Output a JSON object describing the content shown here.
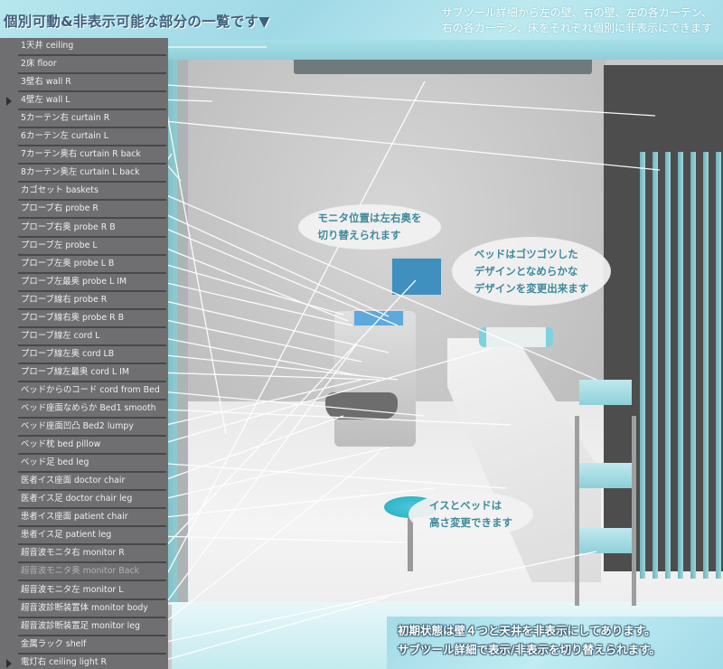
{
  "header": {
    "title": "個別可動&非表示可能な部分の一覧です▼",
    "note_line1": "サブツール詳細から左の壁、右の壁、左の各カーテン、",
    "note_line2": "右の各カーテン、床をそれぞれ個別に非表示にできます"
  },
  "parts_list": {
    "items": [
      {
        "label": "1天井 ceiling",
        "marked": false,
        "dim": false
      },
      {
        "label": "2床 floor",
        "marked": false,
        "dim": false
      },
      {
        "label": "3壁右 wall R",
        "marked": false,
        "dim": false
      },
      {
        "label": "4壁左 wall L",
        "marked": true,
        "dim": false
      },
      {
        "label": "5カーテン右 curtain R",
        "marked": false,
        "dim": false
      },
      {
        "label": "6カーテン左 curtain L",
        "marked": false,
        "dim": false
      },
      {
        "label": "7カーテン奥右 curtain R back",
        "marked": false,
        "dim": false
      },
      {
        "label": "8カーテン奥左 curtain L back",
        "marked": false,
        "dim": false
      },
      {
        "label": "カゴセット baskets",
        "marked": false,
        "dim": false
      },
      {
        "label": "プローブ右 probe R",
        "marked": false,
        "dim": false
      },
      {
        "label": "プローブ右奥 probe R B",
        "marked": false,
        "dim": false
      },
      {
        "label": "プローブ左 probe L",
        "marked": false,
        "dim": false
      },
      {
        "label": "プローブ左奥 probe L B",
        "marked": false,
        "dim": false
      },
      {
        "label": "プローブ左最奥 probe L IM",
        "marked": false,
        "dim": false
      },
      {
        "label": "プローブ線右 probe R",
        "marked": false,
        "dim": false
      },
      {
        "label": "プローブ線右奥 probe R B",
        "marked": false,
        "dim": false
      },
      {
        "label": "プローブ線左 cord L",
        "marked": false,
        "dim": false
      },
      {
        "label": "プローブ線左奥 cord LB",
        "marked": false,
        "dim": false
      },
      {
        "label": "プローブ線左最奥 cord L IM",
        "marked": false,
        "dim": false
      },
      {
        "label": "ベッドからのコード cord from Bed",
        "marked": false,
        "dim": false
      },
      {
        "label": "ベッド座面なめらか Bed1 smooth",
        "marked": false,
        "dim": false
      },
      {
        "label": "ベッド座面凹凸 Bed2 lumpy",
        "marked": false,
        "dim": false
      },
      {
        "label": "ベッド枕 bed pillow",
        "marked": false,
        "dim": false
      },
      {
        "label": "ベッド足 bed leg",
        "marked": false,
        "dim": false
      },
      {
        "label": "医者イス座面 doctor chair",
        "marked": false,
        "dim": false
      },
      {
        "label": "医者イス足 doctor chair leg",
        "marked": false,
        "dim": false
      },
      {
        "label": "患者イス座面 patient chair",
        "marked": false,
        "dim": false
      },
      {
        "label": "患者イス足  patient leg",
        "marked": false,
        "dim": false
      },
      {
        "label": "超音波モニタ右 monitor R",
        "marked": false,
        "dim": false
      },
      {
        "label": "超音波モニタ奥 monitor Back",
        "marked": false,
        "dim": true
      },
      {
        "label": "超音波モニタ左 monitor L",
        "marked": false,
        "dim": false
      },
      {
        "label": "超音波診断装置体 monitor body",
        "marked": false,
        "dim": false
      },
      {
        "label": "超音波診断装置足 monitor leg",
        "marked": false,
        "dim": false
      },
      {
        "label": "金属ラック shelf",
        "marked": false,
        "dim": false
      },
      {
        "label": "電灯右  ceiling light R",
        "marked": true,
        "dim": false
      }
    ]
  },
  "callouts": {
    "monitor": {
      "line1": "モニタ位置は左右奥を",
      "line2": "切り替えられます"
    },
    "bed": {
      "line1": "ベッドはゴツゴツした",
      "line2": "デザインとなめらかな",
      "line3": "デザインを変更出来ます"
    },
    "chair": {
      "line1": "イスとベッドは",
      "line2": "高さ変更できます"
    }
  },
  "footer": {
    "line1": "初期状態は壁４つと天井を非表示にしてあります。",
    "line2": "サブツール詳細で表示/非表示を切り替えられます。"
  },
  "colors": {
    "accent": "#9fd9e6",
    "list_bg": "#6f6f71",
    "callout_text": "#3f8a9c",
    "title_text": "#3f5f7d"
  }
}
